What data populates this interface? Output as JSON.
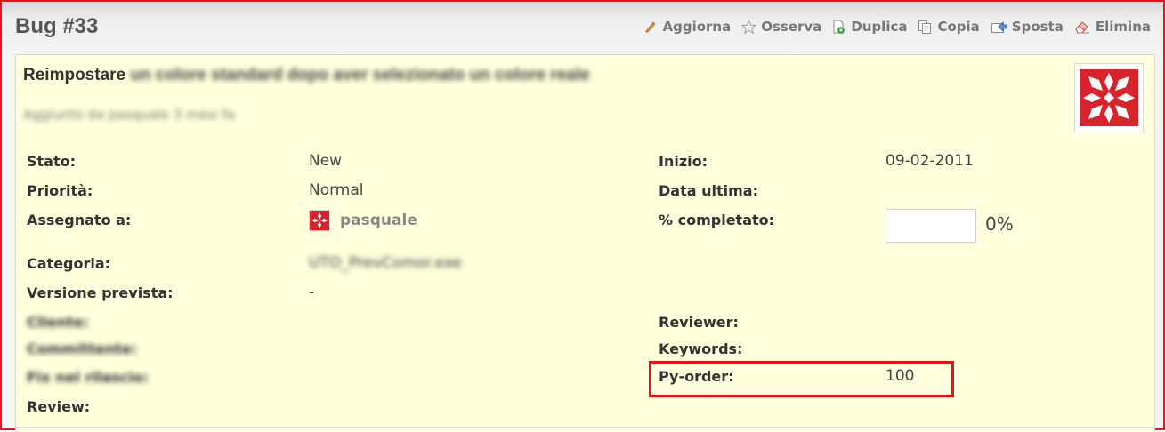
{
  "header": {
    "title": "Bug #33"
  },
  "toolbar": {
    "items": [
      {
        "label": "Aggiorna",
        "icon": "edit-pencil-icon"
      },
      {
        "label": "Osserva",
        "icon": "star-icon"
      },
      {
        "label": "Duplica",
        "icon": "duplicate-icon"
      },
      {
        "label": "Copia",
        "icon": "copy-icon"
      },
      {
        "label": "Sposta",
        "icon": "move-icon"
      },
      {
        "label": "Elimina",
        "icon": "eraser-icon"
      }
    ]
  },
  "issue": {
    "subject_start": "Reimpostare",
    "subject_rest": "un colore standard dopo aver selezionato un colore reale",
    "author_line": "Aggiunto da pasquale 3 mesi fa"
  },
  "fields_left": [
    {
      "label": "Stato:",
      "value": "New"
    },
    {
      "label": "Priorità:",
      "value": "Normal"
    },
    {
      "label": "Assegnato a:",
      "value": "pasquale"
    },
    {
      "label": "Categoria:",
      "value": "UTO_PrevComor.exe"
    },
    {
      "label": "Versione prevista:",
      "value": "-"
    },
    {
      "label": "Cliente:",
      "value": ""
    },
    {
      "label": "Committente:",
      "value": ""
    },
    {
      "label": "Fix nel rilascio:",
      "value": ""
    },
    {
      "label": "Review:",
      "value": ""
    }
  ],
  "fields_right": [
    {
      "label": "Inizio:",
      "value": "09-02-2011"
    },
    {
      "label": "Data ultima:",
      "value": ""
    },
    {
      "label": "% completato:",
      "value": "0%"
    },
    {
      "label": "Reviewer:",
      "value": ""
    },
    {
      "label": "Keywords:",
      "value": ""
    },
    {
      "label": "Py-order:",
      "value": "100"
    }
  ],
  "progress": {
    "fraction": 0
  },
  "colors": {
    "highlight": "#e5141a",
    "panel": "#ffffdd",
    "avatar": "#d9232a"
  }
}
